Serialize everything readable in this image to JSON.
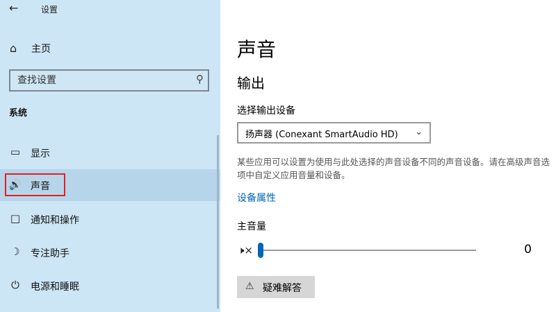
{
  "window": {
    "title": "设置",
    "back_icon": "arrow-left-icon"
  },
  "sidebar": {
    "home_label": "主页",
    "search_placeholder": "查找设置",
    "group_title": "系统",
    "items": [
      {
        "label": "显示",
        "icon": "monitor-icon"
      },
      {
        "label": "声音",
        "icon": "speaker-icon",
        "selected": true
      },
      {
        "label": "通知和操作",
        "icon": "message-icon"
      },
      {
        "label": "专注助手",
        "icon": "moon-icon"
      },
      {
        "label": "电源和睡眠",
        "icon": "power-icon"
      }
    ]
  },
  "main": {
    "title": "声音",
    "section": "输出",
    "output_device_label": "选择输出设备",
    "output_device_value": "扬声器 (Conexant SmartAudio HD)",
    "description": "某些应用可以设置为使用与此处选择的声音设备不同的声音设备。请在高级声音选项中自定义应用音量和设备。",
    "device_properties_link": "设备属性",
    "master_volume_label": "主音量",
    "volume_value": "0",
    "volume_fraction": 0.0,
    "troubleshoot_label": "疑难解答"
  },
  "colors": {
    "accent": "#0067b8",
    "sidebar_bg": "#cde6f6",
    "highlight_border": "#e02020"
  }
}
